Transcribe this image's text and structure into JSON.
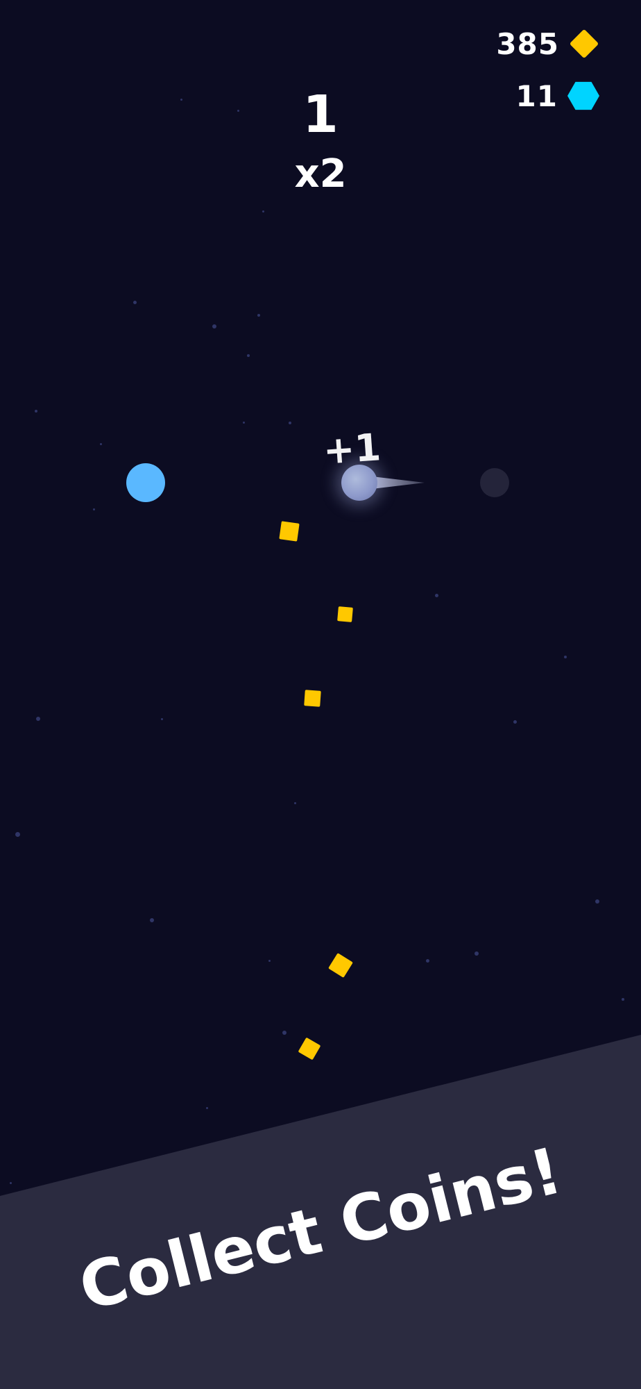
{
  "hud": {
    "coins": {
      "value": "385",
      "icon": "gold-diamond-icon"
    },
    "gems": {
      "value": "11",
      "icon": "cyan-hexagon-icon"
    },
    "score": "1",
    "multiplier": "x2"
  },
  "popup": {
    "text": "+1"
  },
  "banner": {
    "text": "Collect Coins!"
  },
  "colors": {
    "background": "#0c0c22",
    "coin": "#ffc800",
    "gem": "#00d4ff",
    "planet": "#5ab8ff",
    "banner": "#2b2b40"
  }
}
